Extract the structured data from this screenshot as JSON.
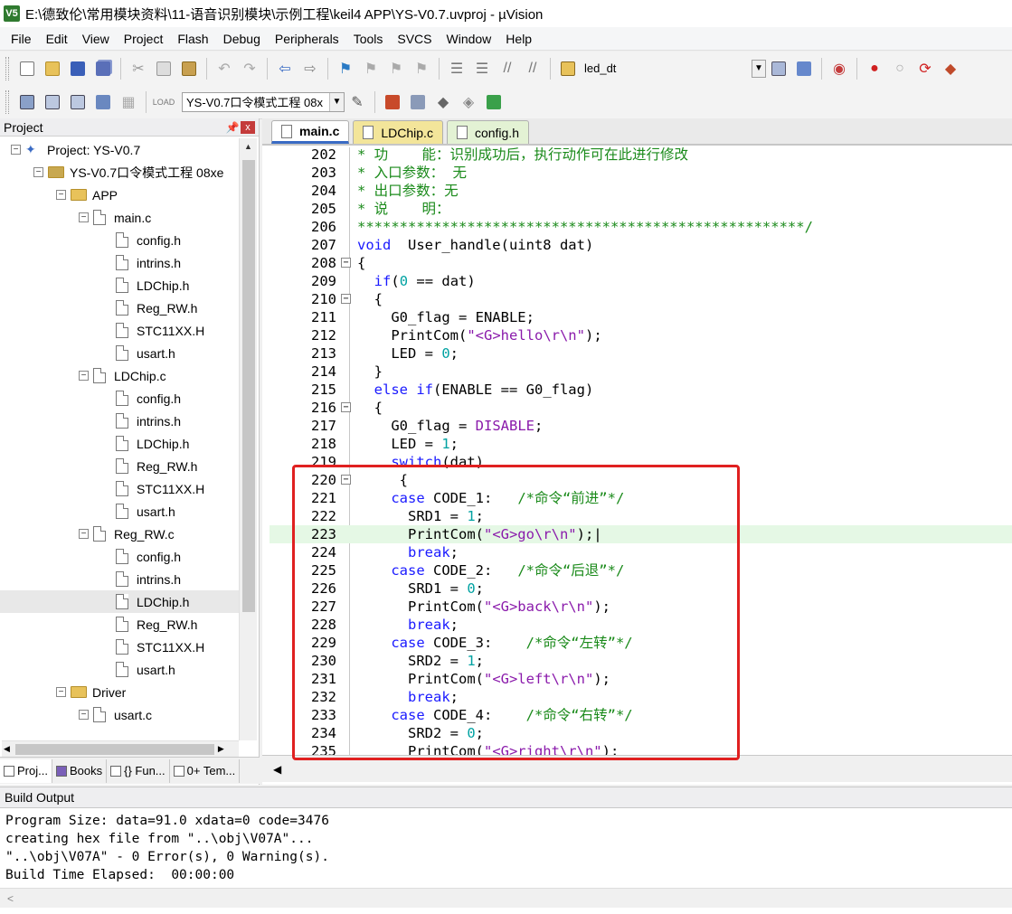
{
  "window": {
    "title": "E:\\德致伦\\常用模块资料\\11-语音识别模块\\示例工程\\keil4 APP\\YS-V0.7.uvproj - µVision",
    "app_badge": "V5"
  },
  "menu": [
    "File",
    "Edit",
    "View",
    "Project",
    "Flash",
    "Debug",
    "Peripherals",
    "Tools",
    "SVCS",
    "Window",
    "Help"
  ],
  "toolbar": {
    "find_combo": "led_dt",
    "target_combo": "YS-V0.7口令模式工程 08x"
  },
  "project_panel": {
    "title": "Project",
    "pin_icon": "📌",
    "close_label": "x",
    "tree": [
      {
        "depth": 0,
        "toggle": "−",
        "icon": "project",
        "label": "Project: YS-V0.7"
      },
      {
        "depth": 1,
        "toggle": "−",
        "icon": "target",
        "label": "YS-V0.7口令模式工程 08xe"
      },
      {
        "depth": 2,
        "toggle": "−",
        "icon": "folder",
        "label": "APP"
      },
      {
        "depth": 3,
        "toggle": "−",
        "icon": "file",
        "label": "main.c"
      },
      {
        "depth": 4,
        "toggle": "",
        "icon": "file",
        "label": "config.h"
      },
      {
        "depth": 4,
        "toggle": "",
        "icon": "file",
        "label": "intrins.h"
      },
      {
        "depth": 4,
        "toggle": "",
        "icon": "file",
        "label": "LDChip.h"
      },
      {
        "depth": 4,
        "toggle": "",
        "icon": "file",
        "label": "Reg_RW.h"
      },
      {
        "depth": 4,
        "toggle": "",
        "icon": "file",
        "label": "STC11XX.H"
      },
      {
        "depth": 4,
        "toggle": "",
        "icon": "file",
        "label": "usart.h"
      },
      {
        "depth": 3,
        "toggle": "−",
        "icon": "file",
        "label": "LDChip.c"
      },
      {
        "depth": 4,
        "toggle": "",
        "icon": "file",
        "label": "config.h"
      },
      {
        "depth": 4,
        "toggle": "",
        "icon": "file",
        "label": "intrins.h"
      },
      {
        "depth": 4,
        "toggle": "",
        "icon": "file",
        "label": "LDChip.h"
      },
      {
        "depth": 4,
        "toggle": "",
        "icon": "file",
        "label": "Reg_RW.h"
      },
      {
        "depth": 4,
        "toggle": "",
        "icon": "file",
        "label": "STC11XX.H"
      },
      {
        "depth": 4,
        "toggle": "",
        "icon": "file",
        "label": "usart.h"
      },
      {
        "depth": 3,
        "toggle": "−",
        "icon": "file",
        "label": "Reg_RW.c"
      },
      {
        "depth": 4,
        "toggle": "",
        "icon": "file",
        "label": "config.h"
      },
      {
        "depth": 4,
        "toggle": "",
        "icon": "file",
        "label": "intrins.h"
      },
      {
        "depth": 4,
        "toggle": "",
        "icon": "file",
        "label": "LDChip.h",
        "selected": true
      },
      {
        "depth": 4,
        "toggle": "",
        "icon": "file",
        "label": "Reg_RW.h"
      },
      {
        "depth": 4,
        "toggle": "",
        "icon": "file",
        "label": "STC11XX.H"
      },
      {
        "depth": 4,
        "toggle": "",
        "icon": "file",
        "label": "usart.h"
      },
      {
        "depth": 2,
        "toggle": "−",
        "icon": "folder",
        "label": "Driver"
      },
      {
        "depth": 3,
        "toggle": "−",
        "icon": "file",
        "label": "usart.c"
      }
    ],
    "tabs": [
      "Proj...",
      "Books",
      "{} Fun...",
      "0+ Tem..."
    ]
  },
  "editor": {
    "tabs": [
      {
        "label": "main.c",
        "active": true,
        "kind": "c"
      },
      {
        "label": "LDChip.c",
        "active": false,
        "kind": "c"
      },
      {
        "label": "config.h",
        "active": false,
        "kind": "h"
      }
    ],
    "lines": [
      {
        "n": "202",
        "fold": "",
        "hl": false,
        "segs": [
          [
            "cm",
            "* 功    能：识别成功后，执行动作可在此进行修改"
          ]
        ]
      },
      {
        "n": "203",
        "fold": "",
        "hl": false,
        "segs": [
          [
            "cm",
            "* 入口参数： 无"
          ]
        ]
      },
      {
        "n": "204",
        "fold": "",
        "hl": false,
        "segs": [
          [
            "cm",
            "* 出口参数：无"
          ]
        ]
      },
      {
        "n": "205",
        "fold": "",
        "hl": false,
        "segs": [
          [
            "cm",
            "* 说    明："
          ]
        ]
      },
      {
        "n": "206",
        "fold": "",
        "hl": false,
        "segs": [
          [
            "cm",
            "*****************************************************/"
          ]
        ]
      },
      {
        "n": "207",
        "fold": "",
        "hl": false,
        "segs": [
          [
            "kw",
            "void"
          ],
          [
            "",
            "  User_handle(uint8 dat)"
          ]
        ]
      },
      {
        "n": "208",
        "fold": "−",
        "hl": false,
        "segs": [
          [
            "",
            "{"
          ]
        ]
      },
      {
        "n": "209",
        "fold": "",
        "hl": false,
        "segs": [
          [
            "",
            "  "
          ],
          [
            "kw",
            "if"
          ],
          [
            "",
            "("
          ],
          [
            "nm",
            "0"
          ],
          [
            "",
            " == dat)"
          ]
        ]
      },
      {
        "n": "210",
        "fold": "−",
        "hl": false,
        "segs": [
          [
            "",
            "  {"
          ]
        ]
      },
      {
        "n": "211",
        "fold": "",
        "hl": false,
        "segs": [
          [
            "",
            "    G0_flag = ENABLE;"
          ]
        ]
      },
      {
        "n": "212",
        "fold": "",
        "hl": false,
        "segs": [
          [
            "",
            "    PrintCom("
          ],
          [
            "st",
            "\"<G>hello\\r\\n\""
          ],
          [
            "",
            ");"
          ]
        ]
      },
      {
        "n": "213",
        "fold": "",
        "hl": false,
        "segs": [
          [
            "",
            "    LED = "
          ],
          [
            "nm",
            "0"
          ],
          [
            "",
            ";"
          ]
        ]
      },
      {
        "n": "214",
        "fold": "",
        "hl": false,
        "segs": [
          [
            "",
            "  }"
          ]
        ]
      },
      {
        "n": "215",
        "fold": "",
        "hl": false,
        "segs": [
          [
            "",
            "  "
          ],
          [
            "kw",
            "else if"
          ],
          [
            "",
            "(ENABLE == G0_flag)"
          ]
        ]
      },
      {
        "n": "216",
        "fold": "−",
        "hl": false,
        "segs": [
          [
            "",
            "  {"
          ]
        ]
      },
      {
        "n": "217",
        "fold": "",
        "hl": false,
        "segs": [
          [
            "",
            "    G0_flag = "
          ],
          [
            "st",
            "DISABLE"
          ],
          [
            "",
            ";"
          ]
        ]
      },
      {
        "n": "218",
        "fold": "",
        "hl": false,
        "segs": [
          [
            "",
            "    LED = "
          ],
          [
            "nm",
            "1"
          ],
          [
            "",
            ";"
          ]
        ]
      },
      {
        "n": "219",
        "fold": "",
        "hl": false,
        "segs": [
          [
            "",
            "    "
          ],
          [
            "kw",
            "switch"
          ],
          [
            "",
            "(dat)"
          ]
        ]
      },
      {
        "n": "220",
        "fold": "−",
        "hl": false,
        "segs": [
          [
            "",
            "     {"
          ]
        ]
      },
      {
        "n": "221",
        "fold": "",
        "hl": false,
        "segs": [
          [
            "",
            "    "
          ],
          [
            "kw",
            "case"
          ],
          [
            "",
            " CODE_1:   "
          ],
          [
            "cm",
            "/*命令“前进”*/"
          ]
        ]
      },
      {
        "n": "222",
        "fold": "",
        "hl": false,
        "segs": [
          [
            "",
            "      SRD1 = "
          ],
          [
            "nm",
            "1"
          ],
          [
            "",
            ";"
          ]
        ]
      },
      {
        "n": "223",
        "fold": "",
        "hl": true,
        "segs": [
          [
            "",
            "      PrintCom("
          ],
          [
            "st",
            "\"<G>go\\r\\n\""
          ],
          [
            "",
            ");|"
          ]
        ]
      },
      {
        "n": "224",
        "fold": "",
        "hl": false,
        "segs": [
          [
            "",
            "      "
          ],
          [
            "kw",
            "break"
          ],
          [
            "",
            ";"
          ]
        ]
      },
      {
        "n": "225",
        "fold": "",
        "hl": false,
        "segs": [
          [
            "",
            "    "
          ],
          [
            "kw",
            "case"
          ],
          [
            "",
            " CODE_2:   "
          ],
          [
            "cm",
            "/*命令“后退”*/"
          ]
        ]
      },
      {
        "n": "226",
        "fold": "",
        "hl": false,
        "segs": [
          [
            "",
            "      SRD1 = "
          ],
          [
            "nm",
            "0"
          ],
          [
            "",
            ";"
          ]
        ]
      },
      {
        "n": "227",
        "fold": "",
        "hl": false,
        "segs": [
          [
            "",
            "      PrintCom("
          ],
          [
            "st",
            "\"<G>back\\r\\n\""
          ],
          [
            "",
            ");"
          ]
        ]
      },
      {
        "n": "228",
        "fold": "",
        "hl": false,
        "segs": [
          [
            "",
            "      "
          ],
          [
            "kw",
            "break"
          ],
          [
            "",
            ";"
          ]
        ]
      },
      {
        "n": "229",
        "fold": "",
        "hl": false,
        "segs": [
          [
            "",
            "    "
          ],
          [
            "kw",
            "case"
          ],
          [
            "",
            " CODE_3:    "
          ],
          [
            "cm",
            "/*命令“左转”*/"
          ]
        ]
      },
      {
        "n": "230",
        "fold": "",
        "hl": false,
        "segs": [
          [
            "",
            "      SRD2 = "
          ],
          [
            "nm",
            "1"
          ],
          [
            "",
            ";"
          ]
        ]
      },
      {
        "n": "231",
        "fold": "",
        "hl": false,
        "segs": [
          [
            "",
            "      PrintCom("
          ],
          [
            "st",
            "\"<G>left\\r\\n\""
          ],
          [
            "",
            ");"
          ]
        ]
      },
      {
        "n": "232",
        "fold": "",
        "hl": false,
        "segs": [
          [
            "",
            "      "
          ],
          [
            "kw",
            "break"
          ],
          [
            "",
            ";"
          ]
        ]
      },
      {
        "n": "233",
        "fold": "",
        "hl": false,
        "segs": [
          [
            "",
            "    "
          ],
          [
            "kw",
            "case"
          ],
          [
            "",
            " CODE_4:    "
          ],
          [
            "cm",
            "/*命令“右转”*/"
          ]
        ]
      },
      {
        "n": "234",
        "fold": "",
        "hl": false,
        "segs": [
          [
            "",
            "      SRD2 = "
          ],
          [
            "nm",
            "0"
          ],
          [
            "",
            ";"
          ]
        ]
      },
      {
        "n": "235",
        "fold": "",
        "hl": false,
        "segs": [
          [
            "",
            "      PrintCom("
          ],
          [
            "st",
            "\"<G>right\\r\\n\""
          ],
          [
            "",
            ");"
          ]
        ]
      }
    ]
  },
  "build_output": {
    "title": "Build Output",
    "lines": [
      "Program Size: data=91.0 xdata=0 code=3476",
      "creating hex file from \"..\\obj\\V07A\"...",
      "\"..\\obj\\V07A\" - 0 Error(s), 0 Warning(s).",
      "Build Time Elapsed:  00:00:00"
    ]
  },
  "colors": {
    "keyword": "#1a1aff",
    "comment": "#1a8a1a",
    "string": "#8a1aab",
    "number": "#00a2a2",
    "highlight": "#e02020"
  }
}
